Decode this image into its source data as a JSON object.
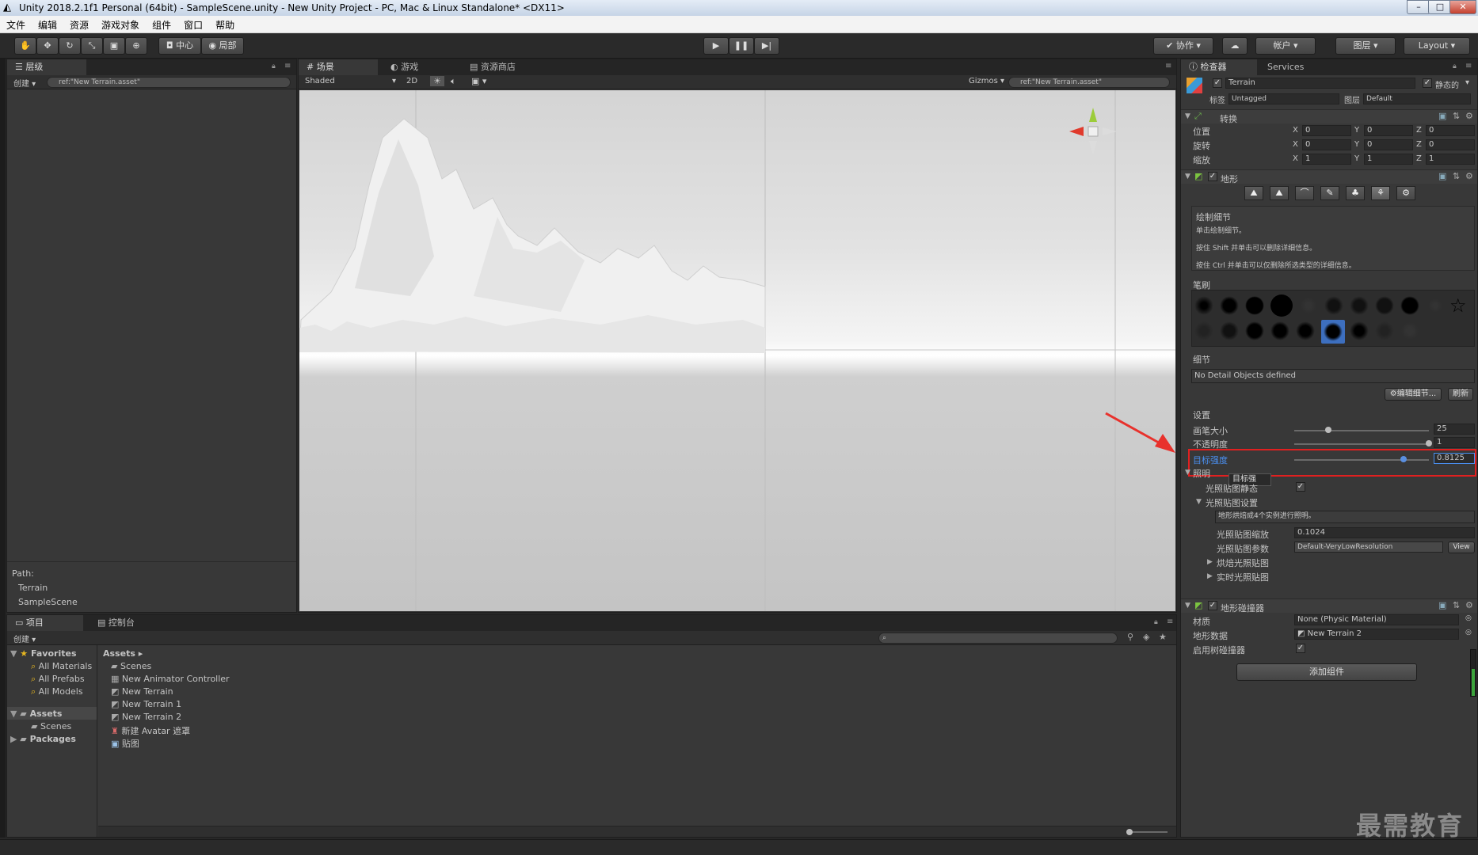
{
  "window": {
    "title": "Unity 2018.2.1f1 Personal (64bit) - SampleScene.unity - New Unity Project - PC, Mac & Linux Standalone* <DX11>"
  },
  "menubar": [
    "文件",
    "编辑",
    "资源",
    "游戏对象",
    "组件",
    "窗口",
    "帮助"
  ],
  "toolbar": {
    "pivot": "中心",
    "space": "局部",
    "collab": "协作",
    "account": "帐户",
    "layers": "图层",
    "layout": "Layout"
  },
  "hierarchy": {
    "tab": "层级",
    "create": "创建",
    "search": "ref:\"New Terrain.asset\"",
    "path_label": "Path:",
    "path": [
      "Terrain",
      "SampleScene"
    ]
  },
  "scene": {
    "tabs": [
      "场景",
      "游戏",
      "资源商店"
    ],
    "shading": "Shaded",
    "mode_2d": "2D",
    "gizmos": "Gizmos",
    "search": "ref:\"New Terrain.asset\""
  },
  "project": {
    "tabs": [
      "项目",
      "控制台"
    ],
    "create": "创建",
    "favorites": {
      "label": "Favorites",
      "items": [
        "All Materials",
        "All Prefabs",
        "All Models"
      ]
    },
    "assets": {
      "label": "Assets",
      "children": [
        "Scenes"
      ]
    },
    "packages": "Packages",
    "breadcrumb": "Assets",
    "files": [
      "Scenes",
      "New Animator Controller",
      "New Terrain",
      "New Terrain 1",
      "New Terrain 2",
      "新建 Avatar 遮罩",
      "贴图"
    ]
  },
  "inspector": {
    "tabs": [
      "检查器",
      "Services"
    ],
    "object_name": "Terrain",
    "static": "静态的",
    "tag_label": "标签",
    "tag": "Untagged",
    "layer_label": "图层",
    "layer": "Default",
    "transform": {
      "title": "转换",
      "rows": [
        {
          "label": "位置",
          "x": "0",
          "y": "0",
          "z": "0"
        },
        {
          "label": "旋转",
          "x": "0",
          "y": "0",
          "z": "0"
        },
        {
          "label": "缩放",
          "x": "1",
          "y": "1",
          "z": "1"
        }
      ]
    },
    "axes": [
      "X",
      "Y",
      "Z"
    ],
    "terrain": {
      "title": "地形",
      "paint_title": "绘制细节",
      "hint1": "单击绘制细节。",
      "hint2": "按住 Shift 并单击可以删除详细信息。",
      "hint3": "按住 Ctrl 并单击可以仅删除所选类型的详细信息。",
      "brushes_label": "笔刷",
      "details_label": "细节",
      "no_details": "No Detail Objects defined",
      "edit_details": "编辑细节...",
      "refresh": "刷新",
      "settings_label": "设置",
      "brush_size": {
        "label": "画笔大小",
        "value": "25",
        "fraction": 0.25
      },
      "opacity": {
        "label": "不透明度",
        "value": "1",
        "fraction": 1.0
      },
      "target_strength": {
        "label": "目标强度",
        "value": "0.8125",
        "fraction": 0.8125
      },
      "lighting_label": "照明",
      "tooltip": "目标强",
      "lightmap_static": "光照贴图静态",
      "lightmap_settings": "光照贴图设置",
      "lightmap_hint": "地形烘焙成4个实例进行照明。",
      "lightmap_scale_label": "光照贴图缩放",
      "lightmap_scale": "0.1024",
      "lightmap_params_label": "光照贴图参数",
      "lightmap_params": "Default-VeryLowResolution",
      "view": "View",
      "baked": "烘焙光照贴图",
      "realtime": "实时光照贴图"
    },
    "collider": {
      "title": "地形碰撞器",
      "material_label": "材质",
      "material": "None (Physic Material)",
      "data_label": "地形数据",
      "data": "New Terrain 2",
      "trees_label": "启用树碰撞器"
    },
    "add_component": "添加组件"
  },
  "watermark": "最需教育",
  "colors": {
    "accent": "#3e7fe6",
    "highlight_box": "#e02020",
    "arrow": "#e8312c"
  }
}
